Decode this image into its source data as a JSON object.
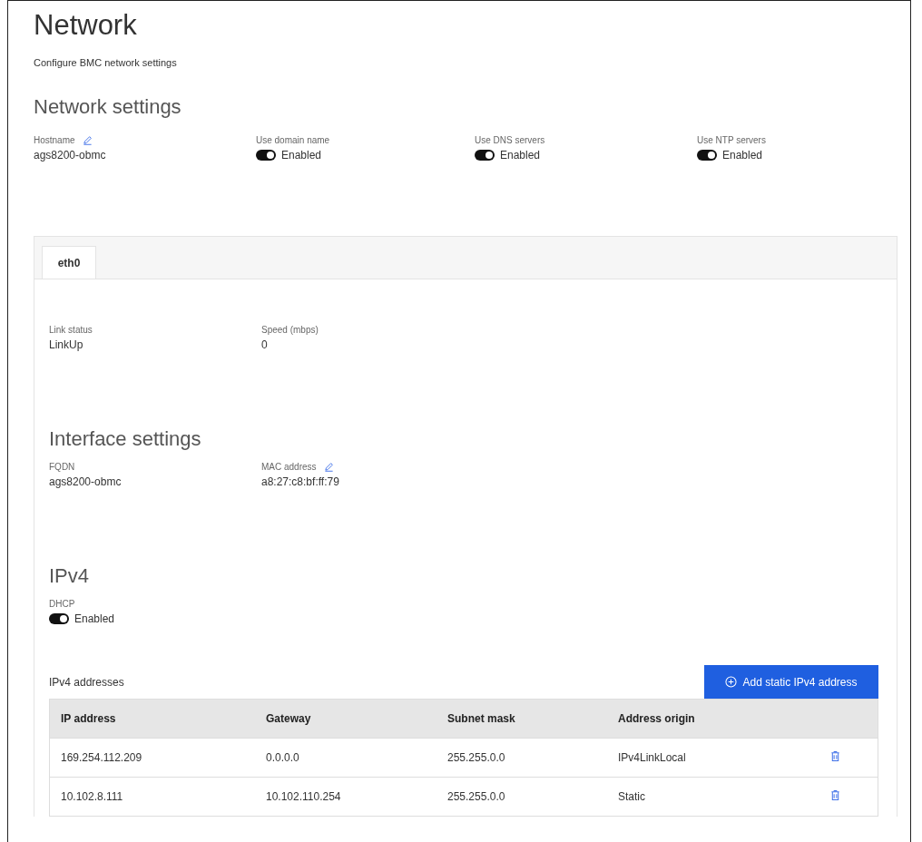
{
  "page": {
    "title": "Network",
    "subtitle": "Configure BMC network settings"
  },
  "network_settings": {
    "heading": "Network settings",
    "items": [
      {
        "kind": "text",
        "label": "Hostname",
        "editable": true,
        "value": "ags8200-obmc"
      },
      {
        "kind": "toggle",
        "label": "Use domain name",
        "on": true,
        "state_label": "Enabled"
      },
      {
        "kind": "toggle",
        "label": "Use DNS servers",
        "on": true,
        "state_label": "Enabled"
      },
      {
        "kind": "toggle",
        "label": "Use NTP servers",
        "on": true,
        "state_label": "Enabled"
      }
    ]
  },
  "tabs": [
    {
      "label": "eth0",
      "selected": true
    }
  ],
  "link": {
    "items": [
      {
        "kind": "text",
        "label": "Link status",
        "value": "LinkUp"
      },
      {
        "kind": "text",
        "label": "Speed (mbps)",
        "value": "0"
      }
    ]
  },
  "interface_settings": {
    "heading": "Interface settings",
    "items": [
      {
        "kind": "text",
        "label": "FQDN",
        "value": "ags8200-obmc"
      },
      {
        "kind": "text",
        "label": "MAC address",
        "editable": true,
        "value": "a8:27:c8:bf:ff:79"
      }
    ]
  },
  "ipv4": {
    "heading": "IPv4",
    "items": [
      {
        "kind": "toggle",
        "label": "DHCP",
        "on": true,
        "state_label": "Enabled"
      }
    ],
    "addresses_label": "IPv4 addresses",
    "add_button": "Add static IPv4 address",
    "table": {
      "columns": [
        "IP address",
        "Gateway",
        "Subnet mask",
        "Address origin"
      ],
      "rows": [
        {
          "cells": [
            "169.254.112.209",
            "0.0.0.0",
            "255.255.0.0",
            "IPv4LinkLocal"
          ]
        },
        {
          "cells": [
            "10.102.8.111",
            "10.102.110.254",
            "255.255.0.0",
            "Static"
          ]
        }
      ]
    }
  }
}
